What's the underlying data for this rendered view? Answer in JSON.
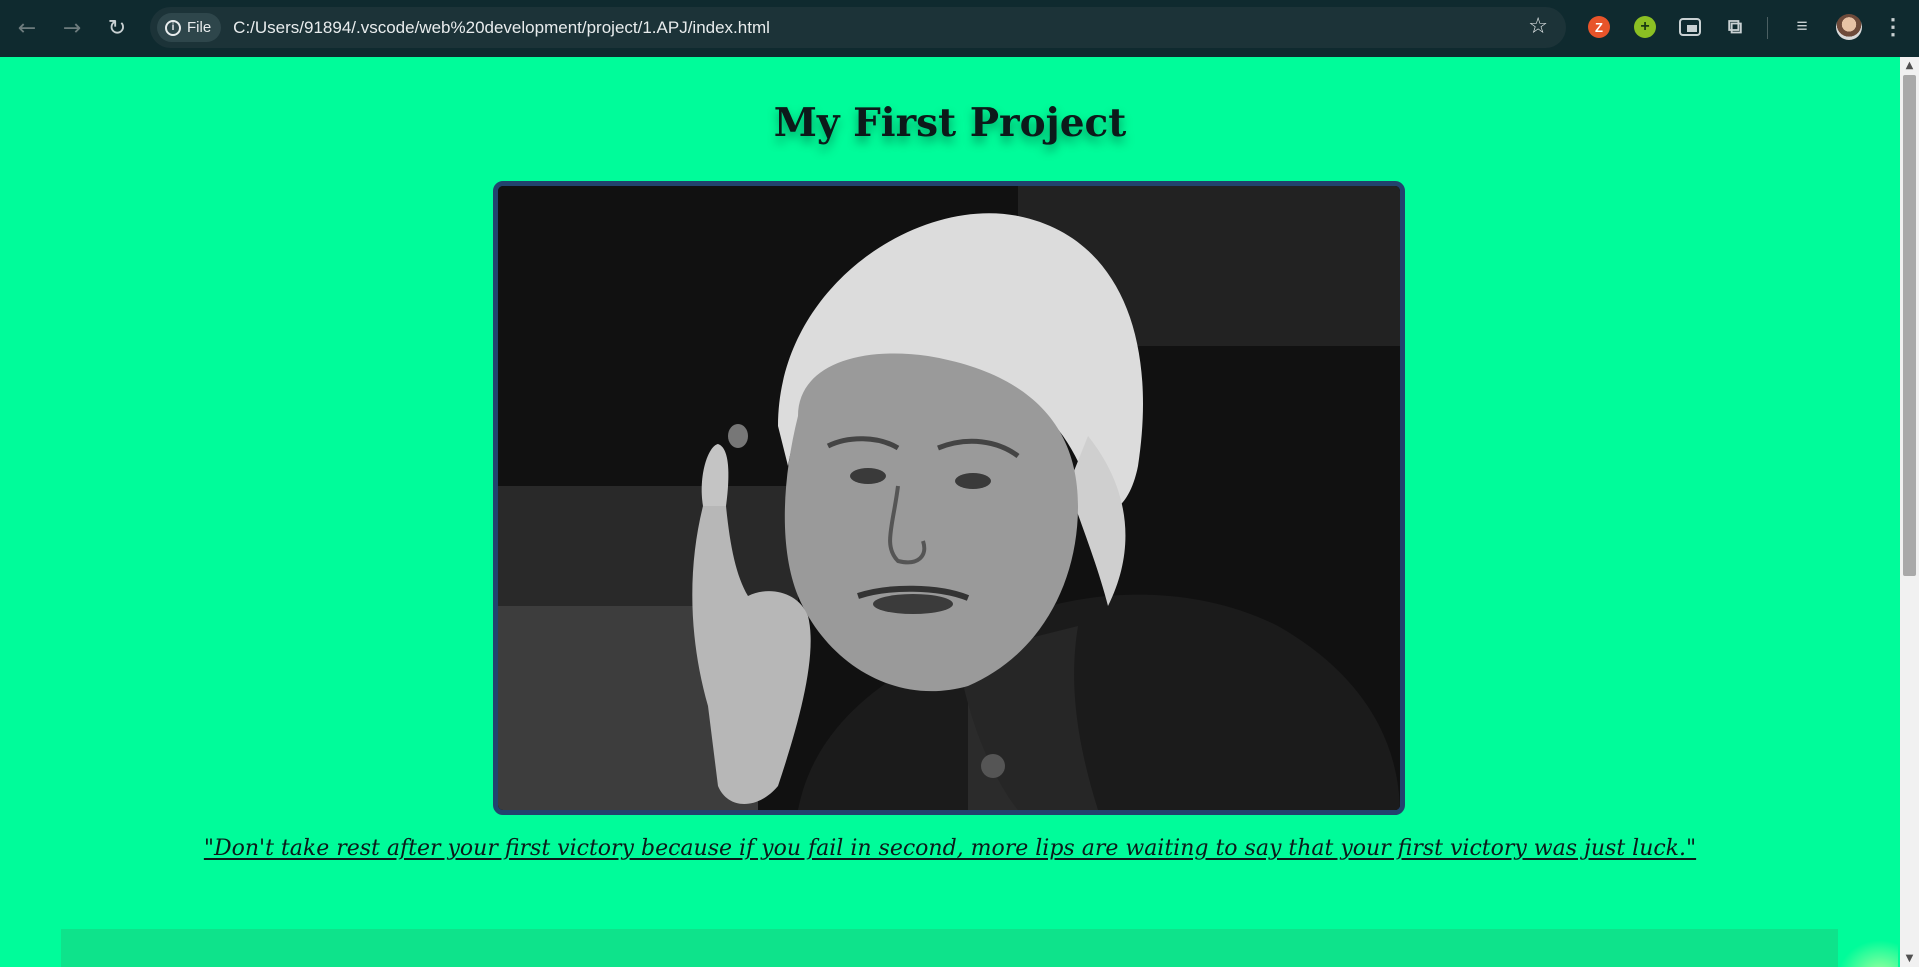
{
  "browser": {
    "back_icon": "arrow-left-icon",
    "forward_icon": "arrow-right-icon",
    "reload_icon": "reload-icon",
    "site_chip_label": "File",
    "url": "C:/Users/91894/.vscode/web%20development/project/1.APJ/index.html",
    "bookmark_icon": "star-icon",
    "extensions": [
      {
        "name": "zotero-extension",
        "glyph": "Z",
        "color": "#e8542a"
      },
      {
        "name": "add-extension",
        "glyph": "+",
        "color": "#8bbf23"
      }
    ]
  },
  "page": {
    "title": "My First Project",
    "quote": "\"Don't take rest after your first victory because if you fail in second, more lips are waiting to say that your first victory was just luck.\"",
    "background_color": "#00fc9a",
    "panel_color": "#0ee38b",
    "portrait_border_color": "#22436e"
  },
  "scrollbar": {
    "up_glyph": "▲",
    "down_glyph": "▼"
  }
}
